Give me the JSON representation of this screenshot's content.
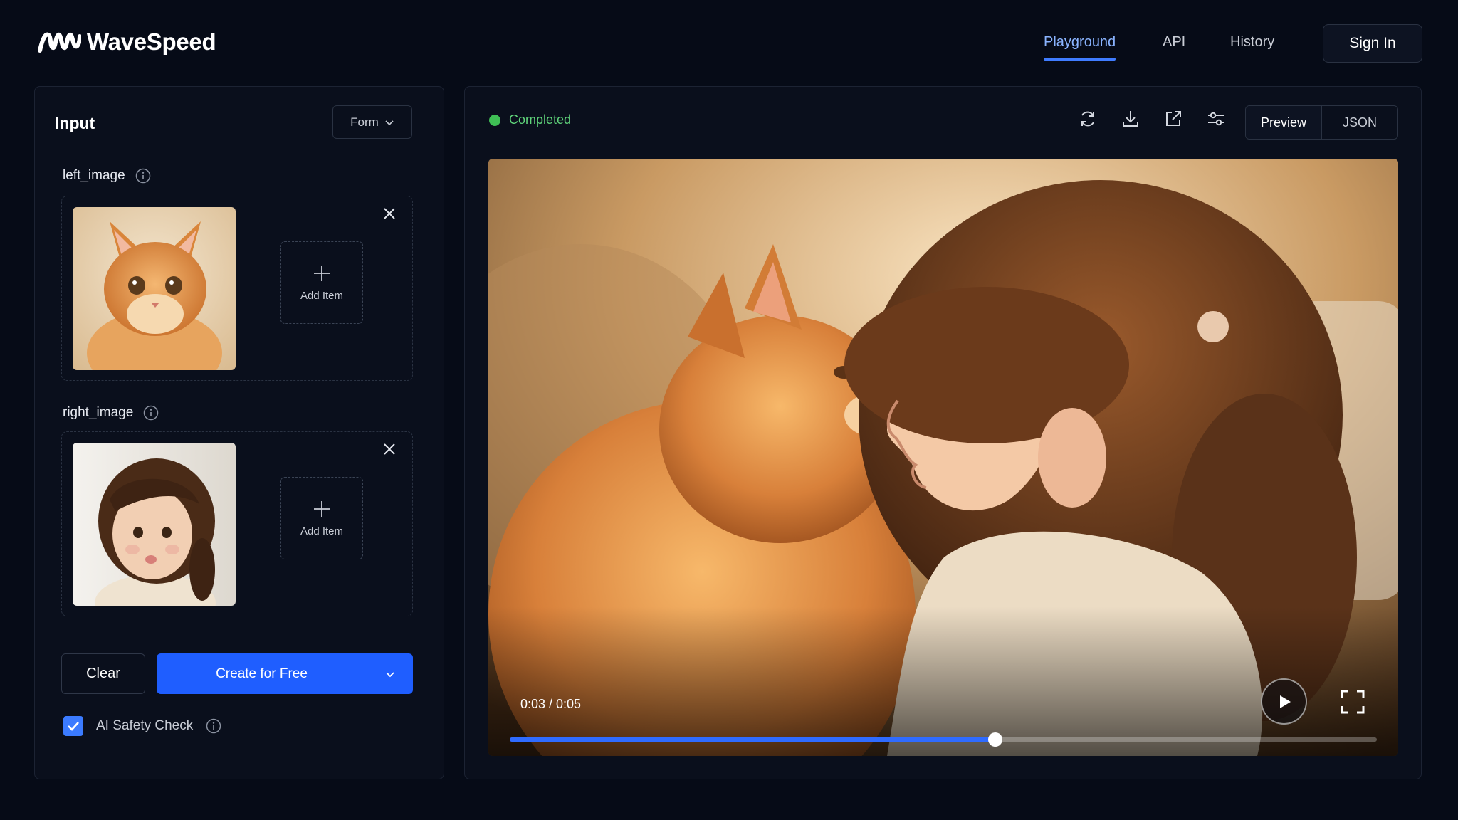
{
  "brand": {
    "name": "WaveSpeed"
  },
  "nav": {
    "items": [
      {
        "label": "Playground",
        "active": true
      },
      {
        "label": "API",
        "active": false
      },
      {
        "label": "History",
        "active": false
      }
    ],
    "signin_label": "Sign In"
  },
  "input_panel": {
    "title": "Input",
    "mode_select": "Form",
    "fields": [
      {
        "label": "left_image",
        "add_label": "Add Item"
      },
      {
        "label": "right_image",
        "add_label": "Add Item"
      }
    ],
    "clear_label": "Clear",
    "create_label": "Create for Free",
    "safety_label": "AI Safety Check",
    "safety_checked": true
  },
  "output_panel": {
    "status": "Completed",
    "status_color": "#3fbf55",
    "toolbar_icons": [
      "refresh-icon",
      "download-icon",
      "open-external-icon",
      "sliders-icon"
    ],
    "views": [
      {
        "label": "Preview",
        "active": true
      },
      {
        "label": "JSON",
        "active": false
      }
    ],
    "video": {
      "time_display": "0:03 / 0:05",
      "progress": 0.56
    }
  },
  "colors": {
    "accent": "#1f5eff",
    "nav_active": "#8ab4ff",
    "background": "#060b17"
  }
}
